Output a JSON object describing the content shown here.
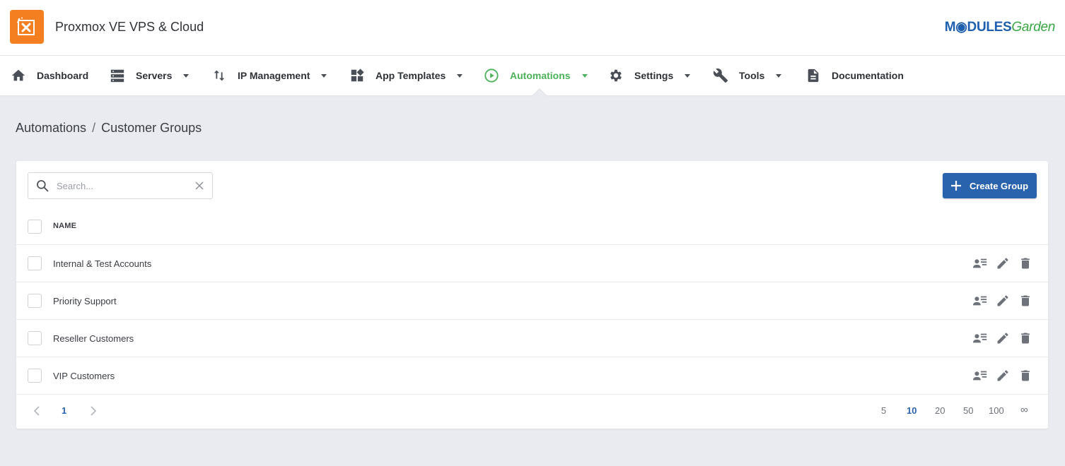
{
  "app": {
    "title": "Proxmox VE VPS & Cloud",
    "brand_part1": "M◉DULES",
    "brand_part2": "Garden"
  },
  "colors": {
    "accent": "#2a63ad",
    "active_nav": "#4cb35a",
    "logo_bg": "#f47f20"
  },
  "nav": {
    "items": [
      {
        "label": "Dashboard",
        "icon": "home-icon"
      },
      {
        "label": "Servers",
        "icon": "server-icon",
        "dropdown": true
      },
      {
        "label": "IP Management",
        "icon": "sort-arrows-icon",
        "dropdown": true
      },
      {
        "label": "App Templates",
        "icon": "widgets-icon",
        "dropdown": true
      },
      {
        "label": "Automations",
        "icon": "play-circle-icon",
        "dropdown": true,
        "active": true
      },
      {
        "label": "Settings",
        "icon": "gear-icon",
        "dropdown": true
      },
      {
        "label": "Tools",
        "icon": "wrench-icon",
        "dropdown": true
      },
      {
        "label": "Documentation",
        "icon": "document-icon"
      }
    ]
  },
  "breadcrumb": {
    "parent": "Automations",
    "separator": "/",
    "current": "Customer Groups"
  },
  "search": {
    "placeholder": "Search...",
    "value": ""
  },
  "toolbar": {
    "create_label": "Create Group"
  },
  "table": {
    "columns": [
      "NAME"
    ],
    "rows": [
      {
        "name": "Internal & Test Accounts"
      },
      {
        "name": "Priority Support"
      },
      {
        "name": "Reseller Customers"
      },
      {
        "name": "VIP Customers"
      }
    ]
  },
  "pagination": {
    "current_page": "1",
    "page_sizes": [
      "5",
      "10",
      "20",
      "50",
      "100",
      "∞"
    ],
    "selected_size": "10"
  }
}
